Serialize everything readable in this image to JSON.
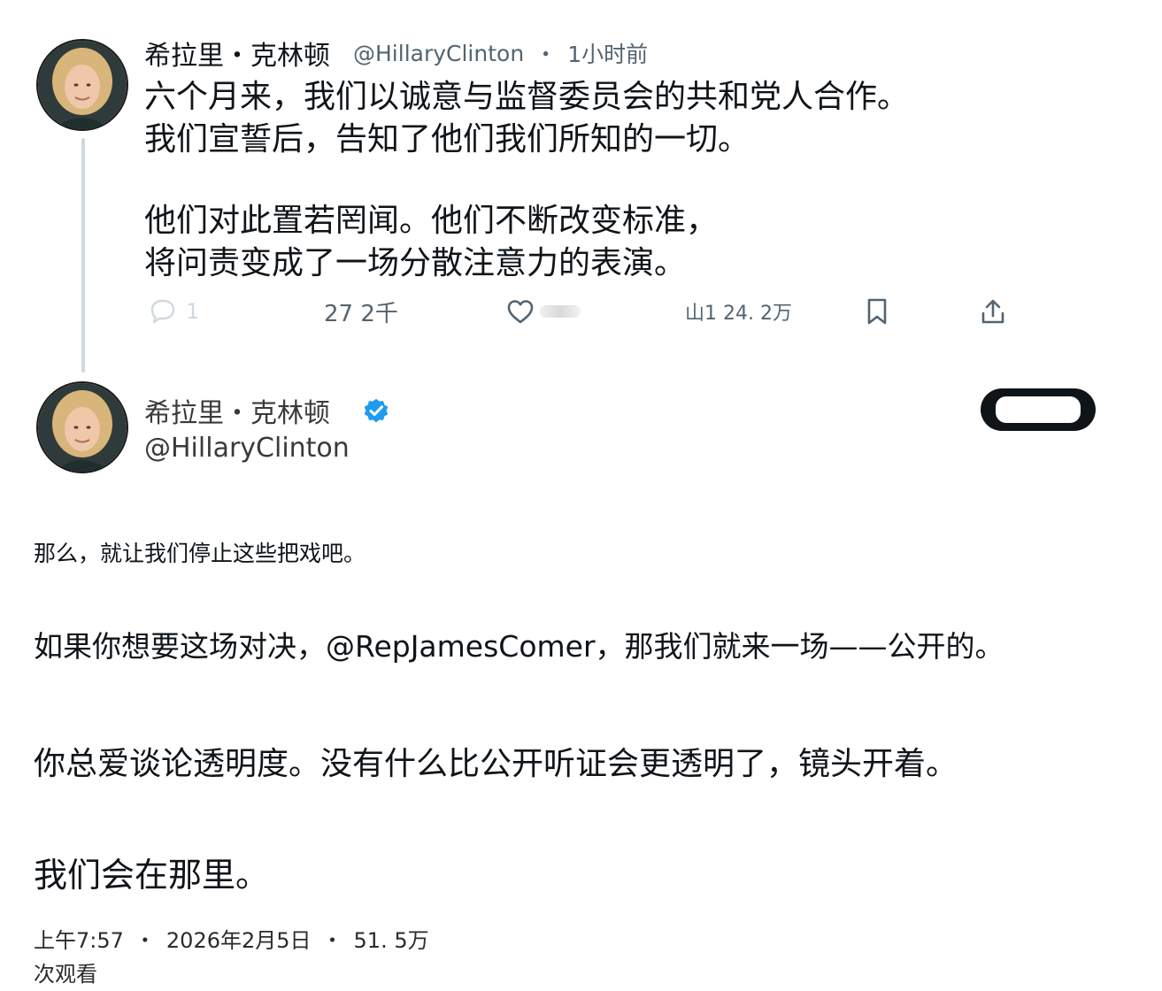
{
  "tweet1": {
    "author_name": "希拉里・克林顿",
    "handle": "@HillaryClinton",
    "separator": "・",
    "time_ago": "1小时前",
    "text_lines": [
      "六个月来，我们以诚意与监督委员会的共和党人合作。",
      "我们宣誓后，告知了他们我们所知的一切。",
      "他们对此置若罔闻。他们不断改变标准，",
      "将问责变成了一场分散注意力的表演。"
    ],
    "actions": {
      "reply_count": "1",
      "retweet_count": "27 2千",
      "views_count": "山1 24. 2万"
    }
  },
  "tweet2": {
    "author_name": "希拉里・克林顿",
    "handle": "@HillaryClinton",
    "text_lines": [
      "那么，就让我们停止这些把戏吧。",
      "如果你想要这场对决，@RepJamesComer，那我们就来一场——公开的。",
      "你总爱谈论透明度。没有什么比公开听证会更透明了，镜头开着。",
      "我们会在那里。"
    ],
    "meta": {
      "time": "上午7:57",
      "separator": "・",
      "date": "2026年2月5日",
      "views": "51. 5万",
      "views_suffix": "次观看"
    }
  },
  "icons": {
    "reply": "reply-bubble-icon",
    "retweet": "retweet-icon",
    "like": "heart-icon",
    "views": "views-bar-icon",
    "bookmark": "bookmark-icon",
    "share": "share-icon",
    "verified": "verified-badge-icon"
  },
  "colors": {
    "text_primary": "#0f1419",
    "text_secondary": "#536471",
    "verified_blue": "#1d9bf0",
    "thread_line": "#cfd9de"
  }
}
